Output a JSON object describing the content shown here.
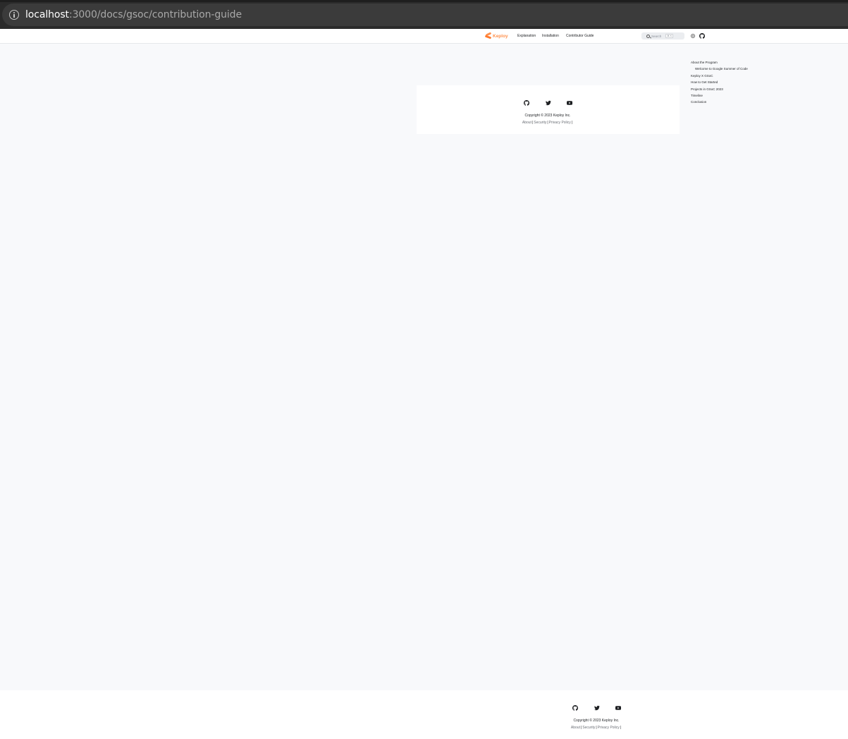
{
  "browser": {
    "url_host": "localhost",
    "url_rest": ":3000/docs/gsoc/contribution-guide"
  },
  "navbar": {
    "brand": "Keploy",
    "links": [
      "Explanation",
      "Installation",
      "Contributor Guide"
    ],
    "search_placeholder": "Search",
    "search_shortcut": "⌘ K"
  },
  "toc": {
    "items": [
      {
        "label": "About the Program",
        "sub": false
      },
      {
        "label": "Welcome to Google Summer of Code",
        "sub": true
      },
      {
        "label": "Keploy X GSoC",
        "sub": false
      },
      {
        "label": "How to Get Started",
        "sub": false
      },
      {
        "label": "Projects in GSoC 2023",
        "sub": false
      },
      {
        "label": "Timeline",
        "sub": false
      },
      {
        "label": "Conclusion",
        "sub": false
      }
    ]
  },
  "footer": {
    "copyright": "Copyright © 2023 Keploy Inc.",
    "links": [
      "About",
      "Security",
      "Privacy Policy"
    ],
    "separator": "|",
    "social_icons": [
      "github-icon",
      "twitter-icon",
      "youtube-icon"
    ]
  }
}
